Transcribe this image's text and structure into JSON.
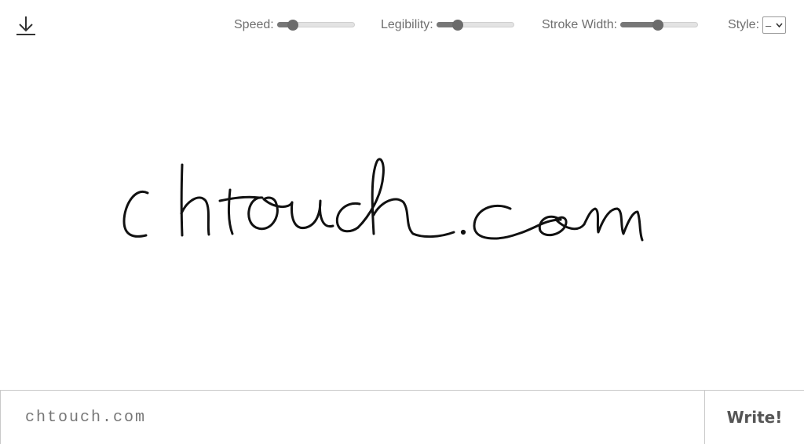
{
  "toolbar": {
    "download_icon": "download-icon",
    "speed": {
      "label": "Speed:",
      "value": 0.2
    },
    "legibility": {
      "label": "Legibility:",
      "value": 0.28
    },
    "stroke_width": {
      "label": "Stroke Width:",
      "value": 0.48
    },
    "style": {
      "label": "Style:",
      "selected": "–"
    }
  },
  "canvas": {
    "rendered_text": "chtouch.com"
  },
  "input": {
    "value": "chtouch.com"
  },
  "write_button": {
    "label": "Write!"
  }
}
